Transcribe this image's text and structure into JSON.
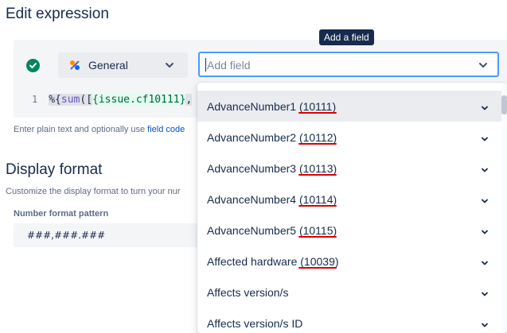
{
  "title": "Edit expression",
  "editor": {
    "type_select": "General",
    "add_field_placeholder": "Add field",
    "tooltip": "Add a field",
    "line_number": "1",
    "code_prefix": "%{",
    "code_fn": "sum",
    "code_open": "([",
    "code_field": "{issue.cf10111}",
    "code_suffix": ","
  },
  "helper": {
    "text": "Enter plain text and optionally use ",
    "link": "field code"
  },
  "display_format": {
    "title": "Display format",
    "description": "Customize the display format to turn your nur",
    "field_label": "Number format pattern",
    "value": "###,###.###"
  },
  "dropdown": {
    "items": [
      {
        "label": "AdvanceNumber1 (10111)"
      },
      {
        "label": "AdvanceNumber2 (10112)"
      },
      {
        "label": "AdvanceNumber3 (10113)"
      },
      {
        "label": "AdvanceNumber4 (10114)"
      },
      {
        "label": "AdvanceNumber5 (10115)"
      },
      {
        "label": "Affected hardware (10039)"
      },
      {
        "label": "Affects version/s"
      },
      {
        "label": "Affects version/s ID"
      }
    ]
  },
  "colors": {
    "accent": "#4c9aff",
    "success": "#00875a",
    "annotation": "#de0000"
  }
}
